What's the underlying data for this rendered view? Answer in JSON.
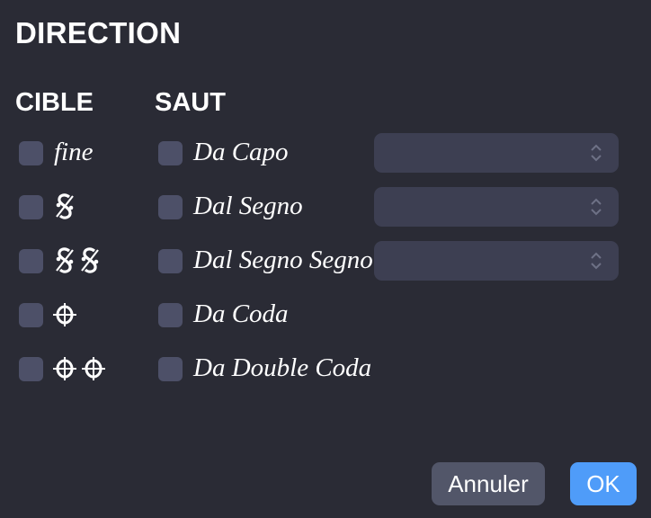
{
  "dialog": {
    "title": "DIRECTION"
  },
  "columns": {
    "target": "CIBLE",
    "jump": "SAUT"
  },
  "targets": [
    {
      "label": "fine",
      "icon": "text",
      "checked": false
    },
    {
      "icon": "segno-icon",
      "checked": false
    },
    {
      "icon": "double-segno-icon",
      "checked": false
    },
    {
      "icon": "coda-icon",
      "checked": false
    },
    {
      "icon": "double-coda-icon",
      "checked": false
    }
  ],
  "jumps": [
    {
      "label": "Da Capo",
      "checked": false,
      "has_select": true,
      "select_value": ""
    },
    {
      "label": "Dal Segno",
      "checked": false,
      "has_select": true,
      "select_value": ""
    },
    {
      "label": "Dal Segno Segno",
      "checked": false,
      "has_select": true,
      "select_value": ""
    },
    {
      "label": "Da Coda",
      "checked": false,
      "has_select": false
    },
    {
      "label": "Da Double Coda",
      "checked": false,
      "has_select": false
    }
  ],
  "buttons": {
    "cancel": "Annuler",
    "ok": "OK"
  },
  "colors": {
    "background": "#2a2b35",
    "checkbox": "#4d5068",
    "select": "#3d3f52",
    "cancel_button": "#525669",
    "ok_button": "#4f9cf9"
  }
}
